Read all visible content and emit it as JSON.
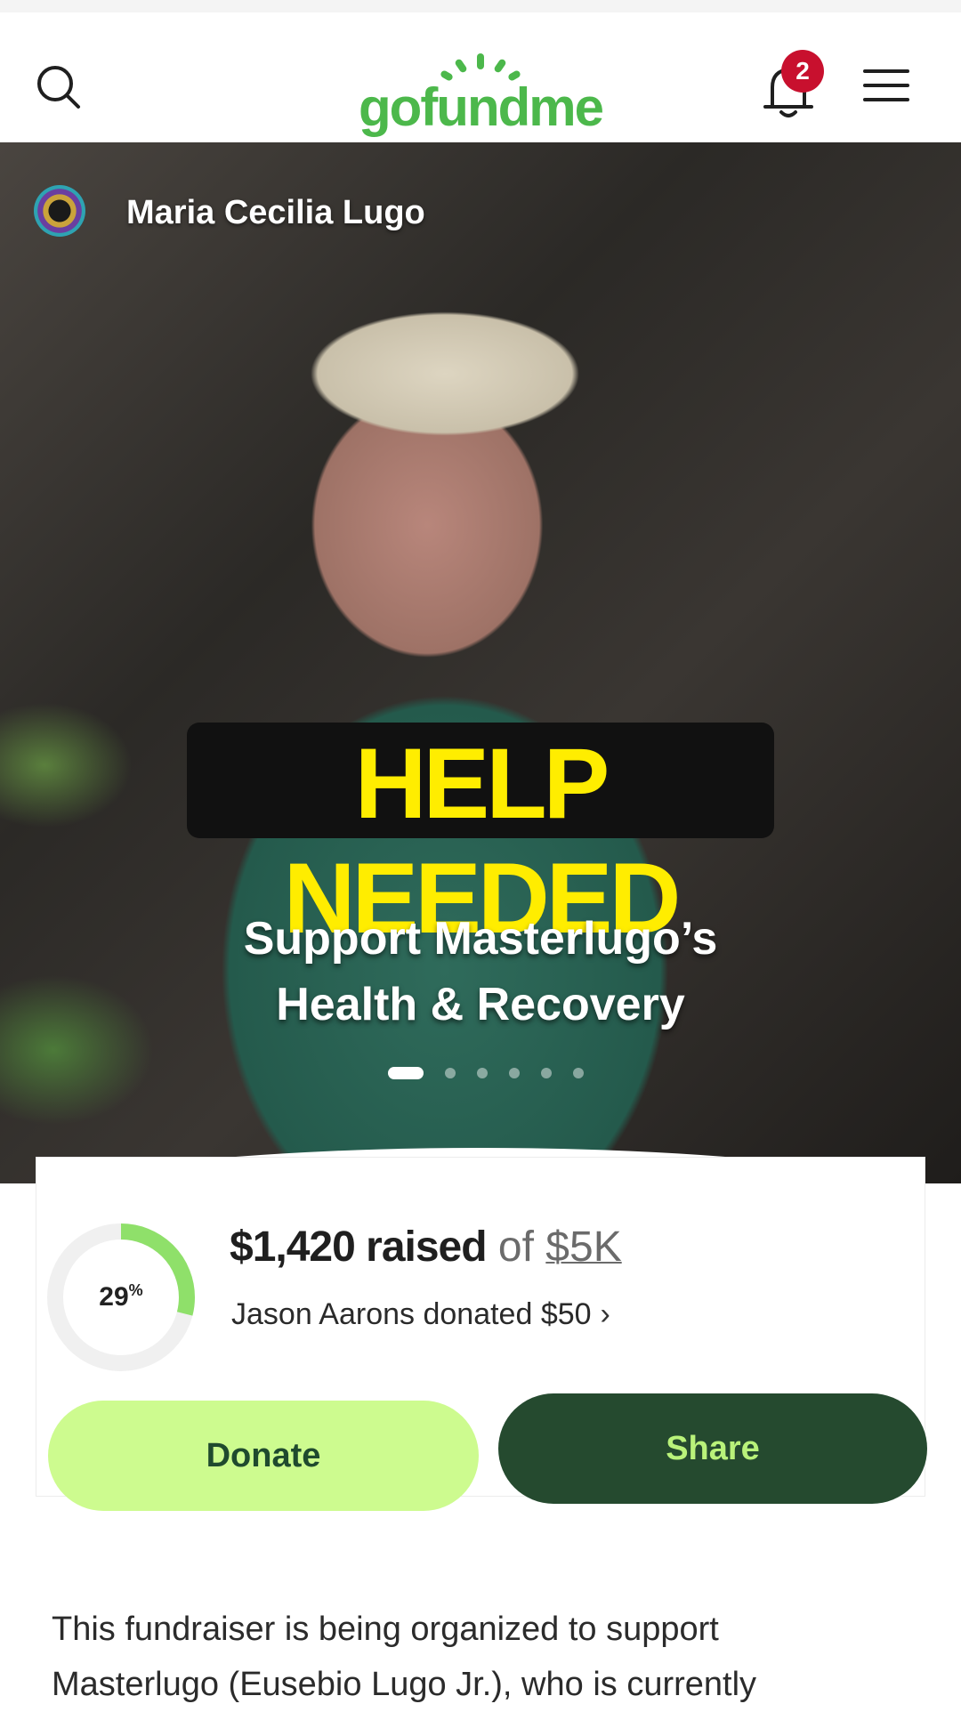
{
  "header": {
    "logo_text": "gofundme",
    "notification_count": "2",
    "icons": [
      "search-icon",
      "bell-icon",
      "menu-icon"
    ]
  },
  "hero": {
    "organizer_name": "Maria Cecilia Lugo",
    "banner_text": "HELP NEEDED",
    "subtitle_line1": "Support Masterlugo’s",
    "subtitle_line2": "Health & Recovery",
    "carousel": {
      "total": 6,
      "active_index": 0
    }
  },
  "stats": {
    "percent_value": 29,
    "percent_number": "29",
    "percent_sign": "%",
    "raised_amount": "$1,420 raised",
    "of_text": "of",
    "goal_amount": "$5K",
    "recent_donation": "Jason Aarons donated $50",
    "chevron": "›"
  },
  "actions": {
    "donate_label": "Donate",
    "share_label": "Share"
  },
  "description": {
    "line1": "This fundraiser is being organized to support",
    "line2": "Masterlugo (Eusebio Lugo Jr.), who is currently"
  },
  "colors": {
    "brand_green": "#4cb84b",
    "donate_bg": "#cdfb8f",
    "share_bg": "#254a2f",
    "badge_red": "#c8102e",
    "banner_yellow": "#ffed00"
  }
}
